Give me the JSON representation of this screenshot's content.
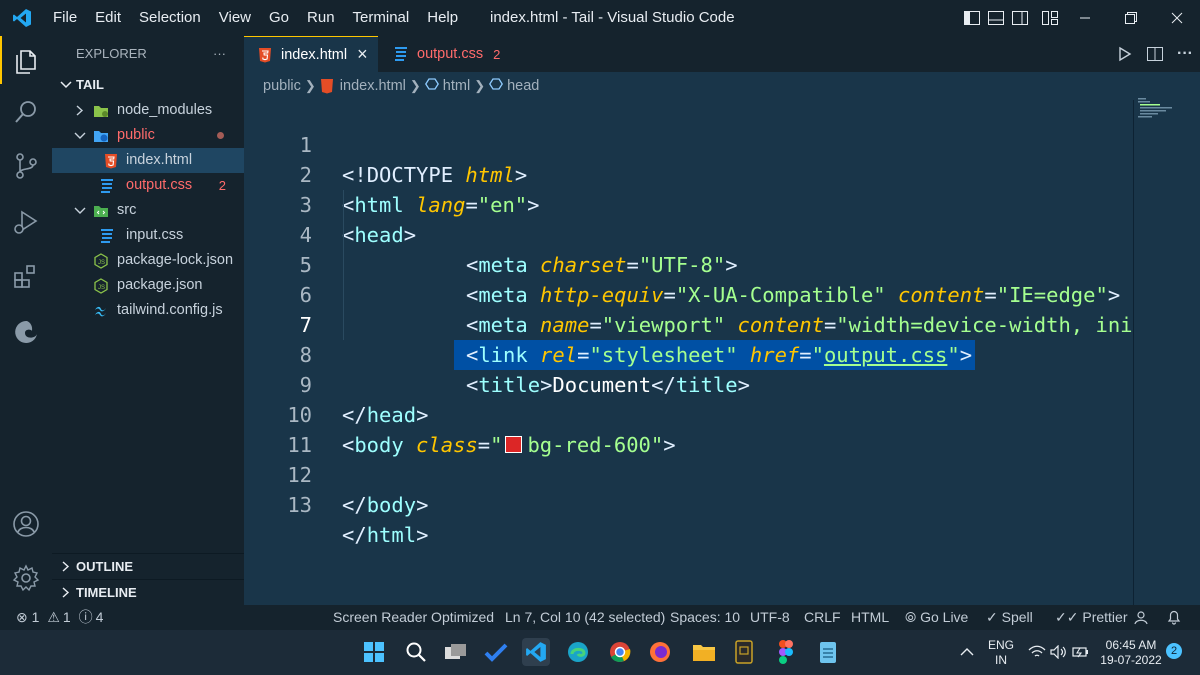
{
  "titlebar": {
    "menu": [
      "File",
      "Edit",
      "Selection",
      "View",
      "Go",
      "Run",
      "Terminal",
      "Help"
    ],
    "title": "index.html - Tail - Visual Studio Code"
  },
  "sidebar": {
    "header": "EXPLORER",
    "more": "···",
    "root": "TAIL",
    "items": [
      {
        "label": "node_modules",
        "icon": "folder-node-icon"
      },
      {
        "label": "public",
        "icon": "folder-public-icon"
      },
      {
        "label": "index.html",
        "icon": "html5-icon"
      },
      {
        "label": "output.css",
        "icon": "css-icon",
        "badge": "2"
      },
      {
        "label": "src",
        "icon": "folder-src-icon"
      },
      {
        "label": "input.css",
        "icon": "css-icon"
      },
      {
        "label": "package-lock.json",
        "icon": "nodejs-icon"
      },
      {
        "label": "package.json",
        "icon": "nodejs-icon"
      },
      {
        "label": "tailwind.config.js",
        "icon": "tailwind-icon"
      }
    ],
    "outline": "OUTLINE",
    "timeline": "TIMELINE"
  },
  "tabs": [
    {
      "label": "index.html",
      "close": "×"
    },
    {
      "label": "output.css",
      "badge": "2"
    }
  ],
  "breadcrumb": [
    "public",
    "index.html",
    "html",
    "head"
  ],
  "editor": {
    "line_numbers": [
      "1",
      "2",
      "3",
      "4",
      "5",
      "6",
      "7",
      "8",
      "9",
      "10",
      "11",
      "12",
      "13"
    ],
    "lines": {
      "l1": {
        "a": "<!",
        "b": "DOCTYPE",
        "c": " html",
        "d": ">"
      },
      "l2": {
        "a": "<",
        "b": "html",
        "c": " lang",
        "d": "=",
        "e": "\"en\"",
        "f": ">"
      },
      "l3": {
        "a": "<",
        "b": "head",
        "c": ">"
      },
      "l4": {
        "a": "<",
        "b": "meta",
        "c": " charset",
        "d": "=",
        "e": "\"UTF-8\"",
        "f": ">"
      },
      "l5": {
        "a": "<",
        "b": "meta",
        "c": " http-equiv",
        "d": "=",
        "e": "\"X-UA-Compatible\"",
        "f": " content",
        "g": "=",
        "h": "\"IE=edge\"",
        "i": ">"
      },
      "l6": {
        "a": "<",
        "b": "meta",
        "c": " name",
        "d": "=",
        "e": "\"viewport\"",
        "f": " content",
        "g": "=",
        "h": "\"width=device-width, ini"
      },
      "l7": {
        "a": "<",
        "b": "link",
        "c": " rel",
        "d": "=",
        "e": "\"stylesheet\"",
        "f": " href",
        "g": "=",
        "h": "\"",
        "i": "output.css",
        "j": "\"",
        "k": ">"
      },
      "l8": {
        "a": "<",
        "b": "title",
        "c": ">",
        "d": "Document",
        "e": "</",
        "f": "title",
        "g": ">"
      },
      "l9": {
        "a": "</",
        "b": "head",
        "c": ">"
      },
      "l10": {
        "a": "<",
        "b": "body",
        "c": " class",
        "d": "=",
        "e": "\"",
        "f": "bg-red-600\"",
        "g": ">"
      },
      "l12": {
        "a": "</",
        "b": "body",
        "c": ">"
      },
      "l13": {
        "a": "</",
        "b": "html",
        "c": ">"
      }
    },
    "color_swatch": "#dc2626"
  },
  "statusbar": {
    "errors": "1",
    "warnings": "1",
    "info": "4",
    "screen_reader": "Screen Reader Optimized",
    "position": "Ln 7, Col 10 (42 selected)",
    "spaces": "Spaces: 10",
    "encoding": "UTF-8",
    "eol": "CRLF",
    "language": "HTML",
    "golive": "Go Live",
    "spell": "Spell",
    "prettier": "Prettier"
  },
  "taskbar": {
    "lang1": "ENG",
    "lang2": "IN",
    "time": "06:45 AM",
    "date": "19-07-2022",
    "notif": "2"
  },
  "colors": {
    "editor_bg": "#193549",
    "sidebar_bg": "#15232d",
    "accent": "#ffc600",
    "selection": "#0050a4",
    "html_icon": "#e44d26",
    "css_icon": "#2e9bf0",
    "error_text": "#ff6b6b"
  }
}
